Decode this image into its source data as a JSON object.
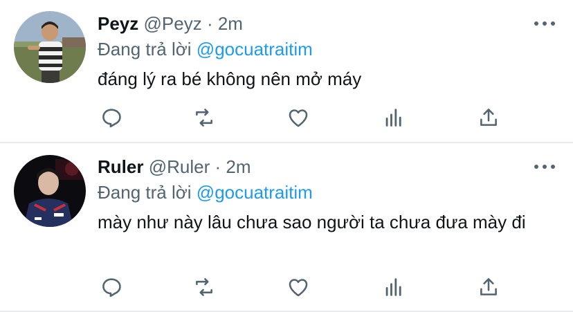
{
  "tweets": [
    {
      "name": "Peyz",
      "handle": "@Peyz",
      "time": "2m",
      "reply_prefix": "Đang trả lời",
      "reply_mention": "@gocuatraitim",
      "text": "đáng lý ra bé không nên mở máy"
    },
    {
      "name": "Ruler",
      "handle": "@Ruler",
      "time": "2m",
      "reply_prefix": "Đang trả lời",
      "reply_mention": "@gocuatraitim",
      "text": "mày như này lâu chưa sao người ta chưa đưa mày đi"
    }
  ],
  "separator": "·",
  "icons": [
    "reply-icon",
    "retweet-icon",
    "like-icon",
    "analytics-icon",
    "share-icon",
    "more-icon"
  ],
  "colors": {
    "link": "#1d9bf0",
    "secondary": "#536471",
    "text": "#0f1419",
    "divider": "#e6ecf0"
  }
}
